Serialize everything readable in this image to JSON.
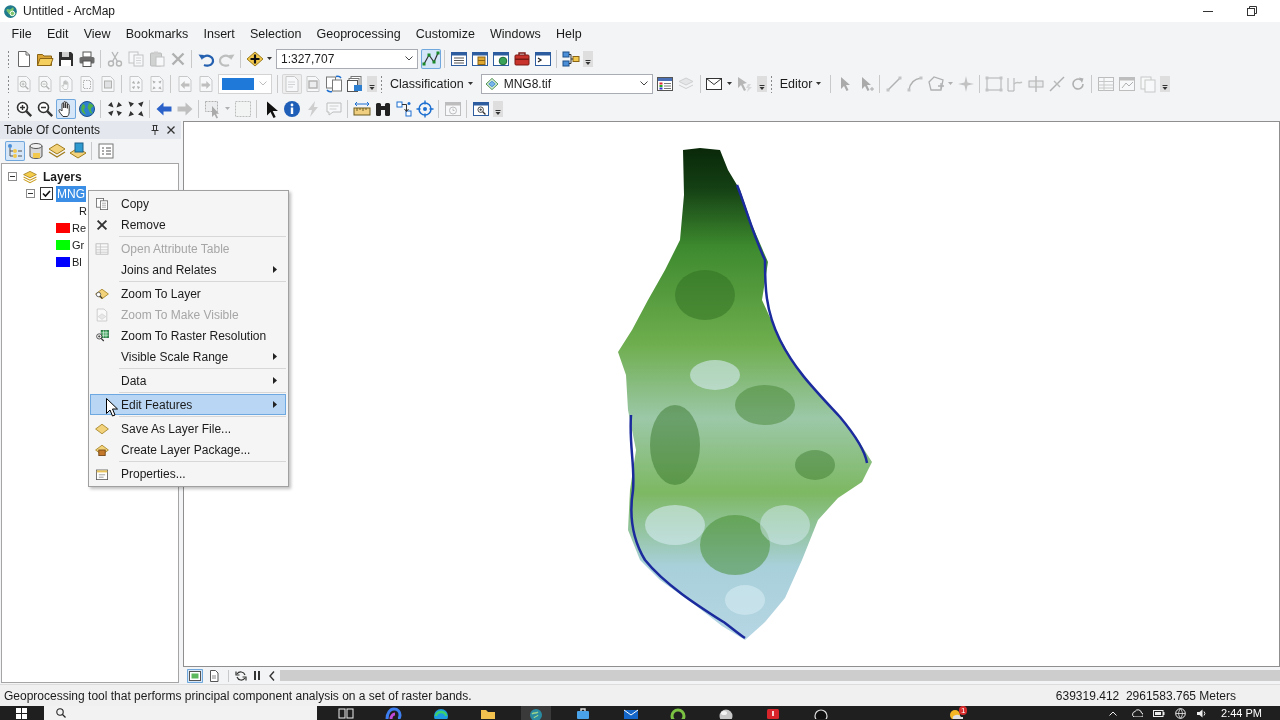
{
  "window": {
    "title": "Untitled - ArcMap"
  },
  "menu_bar": [
    "File",
    "Edit",
    "View",
    "Bookmarks",
    "Insert",
    "Selection",
    "Geoprocessing",
    "Customize",
    "Windows",
    "Help"
  ],
  "toolbars": [
    {
      "items": [
        {
          "kind": "grip"
        },
        {
          "kind": "button",
          "disabled": false,
          "on": false
        },
        {
          "kind": "button",
          "disabled": false,
          "on": false
        },
        {
          "kind": "button",
          "disabled": false,
          "on": false
        },
        {
          "kind": "button",
          "disabled": false,
          "on": false
        },
        {
          "kind": "separator"
        },
        {
          "kind": "button",
          "disabled": true,
          "on": false
        },
        {
          "kind": "button",
          "disabled": true,
          "on": false
        },
        {
          "kind": "button",
          "disabled": true,
          "on": false
        },
        {
          "kind": "button",
          "disabled": true,
          "on": false
        },
        {
          "kind": "separator"
        },
        {
          "kind": "button",
          "disabled": false,
          "on": false
        },
        {
          "kind": "button",
          "disabled": true,
          "on": false
        },
        {
          "kind": "separator"
        },
        {
          "kind": "split",
          "disabled": false,
          "on": false
        },
        {
          "kind": "combo",
          "value": "1:327,707"
        },
        {
          "kind": "button",
          "disabled": false,
          "on": true
        },
        {
          "kind": "separator"
        },
        {
          "kind": "button",
          "disabled": false,
          "on": false
        },
        {
          "kind": "button",
          "disabled": false,
          "on": false
        },
        {
          "kind": "button",
          "disabled": false,
          "on": false
        },
        {
          "kind": "button",
          "disabled": false,
          "on": false
        },
        {
          "kind": "button",
          "disabled": false,
          "on": false
        },
        {
          "kind": "separator"
        },
        {
          "kind": "button",
          "disabled": false,
          "on": false
        },
        {
          "kind": "overflow"
        }
      ]
    },
    {
      "items": [
        {
          "kind": "grip"
        },
        {
          "kind": "button",
          "disabled": true,
          "on": false
        },
        {
          "kind": "button",
          "disabled": true,
          "on": false
        },
        {
          "kind": "button",
          "disabled": true,
          "on": false
        },
        {
          "kind": "button",
          "disabled": true,
          "on": false
        },
        {
          "kind": "button",
          "disabled": true,
          "on": false
        },
        {
          "kind": "separator"
        },
        {
          "kind": "button",
          "disabled": true,
          "on": false
        },
        {
          "kind": "button",
          "disabled": true,
          "on": false
        },
        {
          "kind": "separator"
        },
        {
          "kind": "button",
          "disabled": true,
          "on": false
        },
        {
          "kind": "button",
          "disabled": true,
          "on": false
        },
        {
          "kind": "swatch_combo",
          "disabled": true
        },
        {
          "kind": "separator"
        },
        {
          "kind": "button",
          "disabled": true,
          "on": true
        },
        {
          "kind": "button",
          "disabled": true,
          "on": false
        },
        {
          "kind": "button",
          "disabled": false,
          "on": false
        },
        {
          "kind": "button",
          "disabled": false,
          "on": false
        },
        {
          "kind": "overflow"
        },
        {
          "kind": "grip"
        },
        {
          "kind": "menu",
          "label": "Classification"
        },
        {
          "kind": "layer_combo",
          "value": "MNG8.tif"
        },
        {
          "kind": "button",
          "disabled": false,
          "on": false
        },
        {
          "kind": "button",
          "disabled": true,
          "on": false
        },
        {
          "kind": "separator"
        },
        {
          "kind": "split",
          "disabled": false,
          "on": false
        },
        {
          "kind": "button",
          "disabled": true,
          "on": false
        },
        {
          "kind": "overflow"
        },
        {
          "kind": "grip"
        },
        {
          "kind": "menu",
          "label": "Editor"
        },
        {
          "kind": "separator"
        },
        {
          "kind": "button",
          "disabled": true,
          "on": false
        },
        {
          "kind": "button",
          "disabled": true,
          "on": false
        },
        {
          "kind": "separator"
        },
        {
          "kind": "button",
          "disabled": true,
          "on": false
        },
        {
          "kind": "button",
          "disabled": true,
          "on": false
        },
        {
          "kind": "split",
          "disabled": true,
          "on": false
        },
        {
          "kind": "button",
          "disabled": true,
          "on": false
        },
        {
          "kind": "separator"
        },
        {
          "kind": "button",
          "disabled": true,
          "on": false
        },
        {
          "kind": "button",
          "disabled": true,
          "on": false
        },
        {
          "kind": "button",
          "disabled": true,
          "on": false
        },
        {
          "kind": "button",
          "disabled": true,
          "on": false
        },
        {
          "kind": "button",
          "disabled": true,
          "on": false
        },
        {
          "kind": "separator"
        },
        {
          "kind": "button",
          "disabled": true,
          "on": false
        },
        {
          "kind": "button",
          "disabled": true,
          "on": false
        },
        {
          "kind": "button",
          "disabled": true,
          "on": false
        },
        {
          "kind": "overflow"
        }
      ]
    },
    {
      "items": [
        {
          "kind": "grip"
        },
        {
          "kind": "button",
          "disabled": false,
          "on": false
        },
        {
          "kind": "button",
          "disabled": false,
          "on": false
        },
        {
          "kind": "button",
          "disabled": false,
          "on": true
        },
        {
          "kind": "button",
          "disabled": false,
          "on": false
        },
        {
          "kind": "separator"
        },
        {
          "kind": "button",
          "disabled": false,
          "on": false
        },
        {
          "kind": "button",
          "disabled": false,
          "on": false
        },
        {
          "kind": "separator"
        },
        {
          "kind": "button",
          "disabled": false,
          "on": false
        },
        {
          "kind": "button",
          "disabled": true,
          "on": false
        },
        {
          "kind": "separator"
        },
        {
          "kind": "split",
          "disabled": true,
          "on": false
        },
        {
          "kind": "button",
          "disabled": true,
          "on": false
        },
        {
          "kind": "separator"
        },
        {
          "kind": "button",
          "disabled": false,
          "on": false
        },
        {
          "kind": "button",
          "disabled": false,
          "on": false
        },
        {
          "kind": "button",
          "disabled": true,
          "on": false
        },
        {
          "kind": "button",
          "disabled": true,
          "on": false
        },
        {
          "kind": "separator"
        },
        {
          "kind": "button",
          "disabled": false,
          "on": false
        },
        {
          "kind": "button",
          "disabled": false,
          "on": false
        },
        {
          "kind": "button",
          "disabled": false,
          "on": false
        },
        {
          "kind": "button",
          "disabled": false,
          "on": false
        },
        {
          "kind": "separator"
        },
        {
          "kind": "button",
          "disabled": true,
          "on": false
        },
        {
          "kind": "separator"
        },
        {
          "kind": "button",
          "disabled": false,
          "on": false
        },
        {
          "kind": "overflow"
        }
      ]
    }
  ],
  "table_of_contents": {
    "title": "Table Of Contents",
    "view_tabs": [
      {
        "selected": true
      },
      {
        "selected": false
      },
      {
        "selected": false
      },
      {
        "selected": false
      }
    ],
    "tree": [
      {
        "label": "Layers",
        "selected": false,
        "expanded": true,
        "children": [
          {
            "label": "MNG",
            "checked": true,
            "selected": true,
            "expanded": true,
            "children": [
              {
                "kind": "heading",
                "label": "R"
              },
              {
                "kind": "band",
                "label": "Re",
                "color": "#ff0000"
              },
              {
                "kind": "band",
                "label": "Gr",
                "color": "#00ff00"
              },
              {
                "kind": "band",
                "label": "Bl",
                "color": "#0000ff"
              }
            ]
          }
        ]
      }
    ]
  },
  "context_menu": {
    "items": [
      {
        "kind": "item",
        "label": "Copy",
        "disabled": false,
        "submenu": false,
        "selected": false
      },
      {
        "kind": "item",
        "label": "Remove",
        "disabled": false,
        "submenu": false,
        "selected": false
      },
      {
        "kind": "separator"
      },
      {
        "kind": "item",
        "label": "Open Attribute Table",
        "disabled": true,
        "submenu": false,
        "selected": false
      },
      {
        "kind": "item",
        "label": "Joins and Relates",
        "disabled": false,
        "submenu": true,
        "selected": false
      },
      {
        "kind": "separator"
      },
      {
        "kind": "item",
        "label": "Zoom To Layer",
        "disabled": false,
        "submenu": false,
        "selected": false
      },
      {
        "kind": "item",
        "label": "Zoom To Make Visible",
        "disabled": true,
        "submenu": false,
        "selected": false
      },
      {
        "kind": "item",
        "label": "Zoom To Raster Resolution",
        "disabled": false,
        "submenu": false,
        "selected": false
      },
      {
        "kind": "item",
        "label": "Visible Scale Range",
        "disabled": false,
        "submenu": true,
        "selected": false
      },
      {
        "kind": "separator"
      },
      {
        "kind": "item",
        "label": "Data",
        "disabled": false,
        "submenu": true,
        "selected": false
      },
      {
        "kind": "separator"
      },
      {
        "kind": "item",
        "label": "Edit Features",
        "disabled": false,
        "submenu": true,
        "selected": true
      },
      {
        "kind": "separator"
      },
      {
        "kind": "item",
        "label": "Save As Layer File...",
        "disabled": false,
        "submenu": false,
        "selected": false
      },
      {
        "kind": "item",
        "label": "Create Layer Package...",
        "disabled": false,
        "submenu": false,
        "selected": false
      },
      {
        "kind": "separator"
      },
      {
        "kind": "item",
        "label": "Properties...",
        "disabled": false,
        "submenu": false,
        "selected": false
      }
    ]
  },
  "map_view": {
    "view_buttons": [
      {
        "selected": true
      },
      {
        "selected": false
      }
    ]
  },
  "status_bar": {
    "message": "Geoprocessing tool that performs principal component analysis on a set of raster bands.",
    "coordinates": "639319.412  2961583.765 Meters"
  },
  "taskbar": {
    "notification_badge": "1",
    "clock": "2:44 PM"
  }
}
